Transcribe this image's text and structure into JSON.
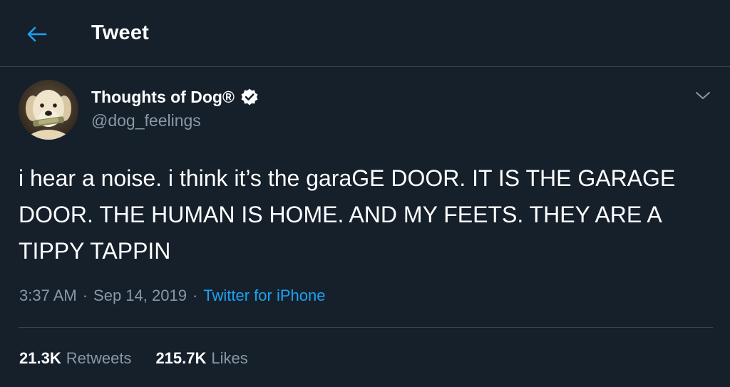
{
  "header": {
    "back_icon": "arrow-left-icon",
    "title": "Tweet"
  },
  "author": {
    "display_name": "Thoughts of Dog®",
    "handle": "@dog_feelings",
    "verified_icon": "verified-badge-icon",
    "avatar": "dog-avatar"
  },
  "menu": {
    "caret_icon": "chevron-down-icon"
  },
  "tweet": {
    "text": "i hear a noise. i think it’s the garaGE DOOR. IT IS THE GARAGE DOOR. THE HUMAN IS HOME. AND MY FEETS. THEY ARE A TIPPY TAPPIN"
  },
  "meta": {
    "time": "3:37 AM",
    "separator": "·",
    "date": "Sep 14, 2019",
    "source": "Twitter for iPhone"
  },
  "stats": {
    "retweets_count": "21.3K",
    "retweets_label": "Retweets",
    "likes_count": "215.7K",
    "likes_label": "Likes"
  },
  "colors": {
    "background": "#15202b",
    "accent": "#1da1f2",
    "secondary_text": "#8899a6",
    "border": "#38444d"
  }
}
